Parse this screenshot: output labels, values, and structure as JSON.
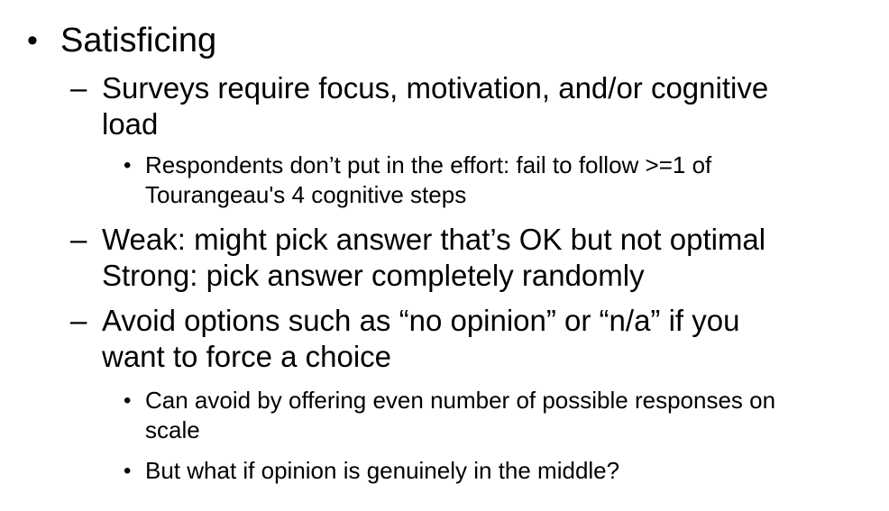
{
  "slide": {
    "level1": {
      "bullet": "•",
      "text": "Satisficing"
    },
    "points": [
      {
        "bullet": "–",
        "lines": [
          "Surveys require focus, motivation, and/or cognitive",
          "load"
        ],
        "subpoints": [
          {
            "bullet": "•",
            "lines": [
              "Respondents don’t put in the effort: fail to follow >=1 of",
              "Tourangeau's 4 cognitive steps"
            ]
          }
        ]
      },
      {
        "bullet": "–",
        "lines": [
          "Weak: might pick answer that’s OK but not optimal",
          "Strong: pick answer completely randomly"
        ],
        "subpoints": []
      },
      {
        "bullet": "–",
        "lines": [
          "Avoid options such as “no opinion” or “n/a” if you",
          "want to force a choice"
        ],
        "subpoints": [
          {
            "bullet": "•",
            "lines": [
              "Can avoid by offering even number of possible responses on",
              "scale"
            ]
          },
          {
            "bullet": "•",
            "lines": [
              "But what if opinion is genuinely in the middle?"
            ]
          }
        ]
      }
    ]
  }
}
